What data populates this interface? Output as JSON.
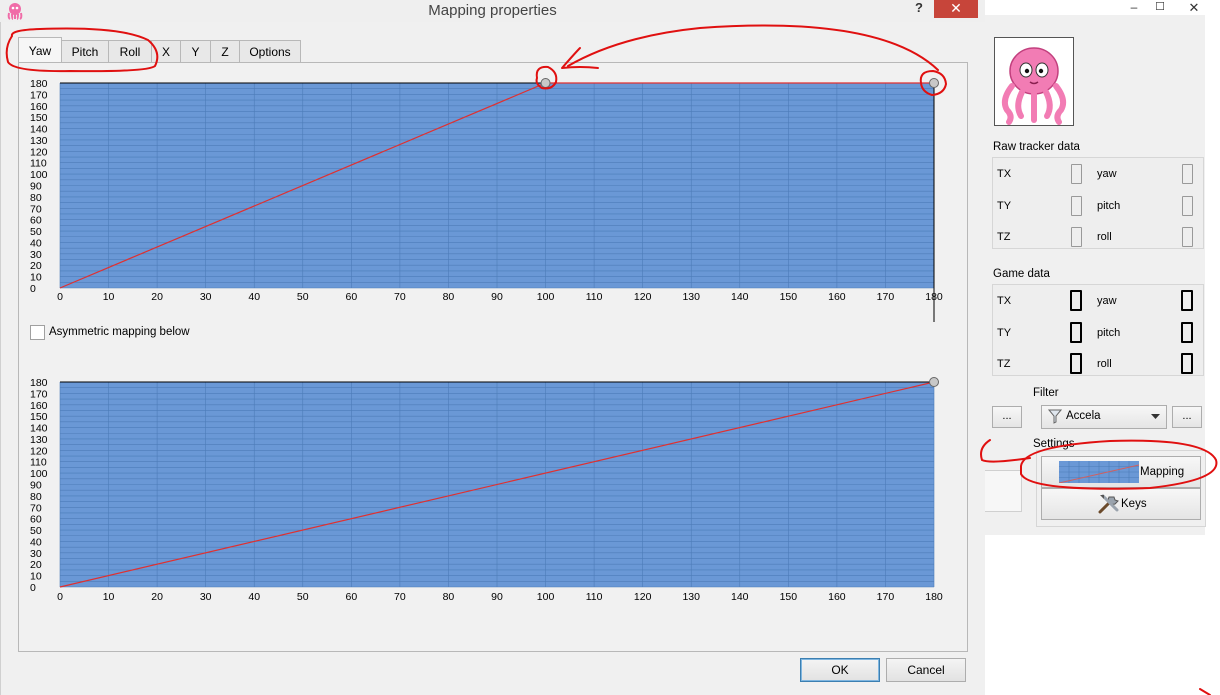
{
  "dialog": {
    "title": "Mapping properties",
    "help_label": "?",
    "close_label": "✕",
    "tabs": [
      "Yaw",
      "Pitch",
      "Roll",
      "X",
      "Y",
      "Z",
      "Options"
    ],
    "active_tab": "Yaw",
    "asymmetric_label": "Asymmetric mapping below",
    "asymmetric_checked": false,
    "ok_label": "OK",
    "cancel_label": "Cancel"
  },
  "chart_data": [
    {
      "type": "line",
      "series": [
        {
          "x": [
            0,
            100,
            180
          ],
          "y": [
            0,
            180,
            180
          ]
        }
      ],
      "control_points": [
        [
          100,
          180
        ],
        [
          180,
          180
        ]
      ],
      "xticks": [
        "0",
        "10",
        "20",
        "30",
        "40",
        "50",
        "60",
        "70",
        "80",
        "90",
        "100",
        "110",
        "120",
        "130",
        "140",
        "150",
        "160",
        "170",
        "180"
      ],
      "yticks": [
        "0",
        "10",
        "20",
        "30",
        "40",
        "50",
        "60",
        "70",
        "80",
        "90",
        "100",
        "110",
        "120",
        "130",
        "140",
        "150",
        "160",
        "170",
        "180"
      ],
      "xlim": [
        0,
        180
      ],
      "ylim": [
        0,
        180
      ],
      "grid": true,
      "background": "#6a98d6",
      "line_color": "#e03030"
    },
    {
      "type": "line",
      "series": [
        {
          "x": [
            0,
            180
          ],
          "y": [
            0,
            180
          ]
        }
      ],
      "control_points": [
        [
          180,
          180
        ]
      ],
      "xticks": [
        "0",
        "10",
        "20",
        "30",
        "40",
        "50",
        "60",
        "70",
        "80",
        "90",
        "100",
        "110",
        "120",
        "130",
        "140",
        "150",
        "160",
        "170",
        "180"
      ],
      "yticks": [
        "0",
        "10",
        "20",
        "30",
        "40",
        "50",
        "60",
        "70",
        "80",
        "90",
        "100",
        "110",
        "120",
        "130",
        "140",
        "150",
        "160",
        "170",
        "180"
      ],
      "xlim": [
        0,
        180
      ],
      "ylim": [
        0,
        180
      ],
      "grid": true,
      "background": "#6a98d6",
      "line_color": "#e03030"
    }
  ],
  "panel": {
    "raw_title": "Raw tracker data",
    "game_title": "Game data",
    "raw_rows": [
      [
        "TX",
        "yaw"
      ],
      [
        "TY",
        "pitch"
      ],
      [
        "TZ",
        "roll"
      ]
    ],
    "game_rows": [
      [
        "TX",
        "yaw"
      ],
      [
        "TY",
        "pitch"
      ],
      [
        "TZ",
        "roll"
      ]
    ],
    "filter_label": "Filter",
    "filter_value": "Accela",
    "settings_label": "Settings",
    "mapping_label": "Mapping",
    "keys_label": "Keys",
    "ellipsis": "...",
    "minimize_label": "–",
    "maximize_label": "☐",
    "close_label": "✕"
  },
  "colors": {
    "annotation": "#e01010",
    "plot_fill": "#6a98d6",
    "accent_close": "#c7453a"
  },
  "icons": [
    "octopus-logo-icon",
    "funnel-icon",
    "tools-icon",
    "chevron-down-icon",
    "close-icon",
    "help-icon"
  ]
}
